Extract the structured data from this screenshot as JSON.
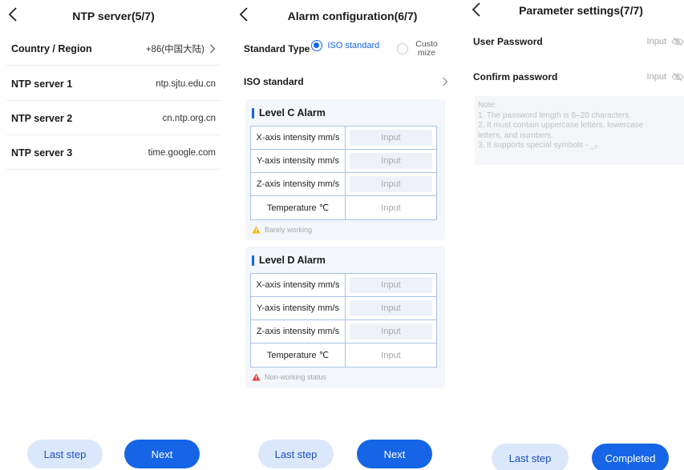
{
  "screen1": {
    "title": "NTP server(5/7)",
    "rows": [
      {
        "label": "Country / Region",
        "value": "+86(中国大陆)"
      },
      {
        "label": "NTP server 1",
        "value": "ntp.sjtu.edu.cn"
      },
      {
        "label": "NTP server 2",
        "value": "cn.ntp.org.cn"
      },
      {
        "label": "NTP server 3",
        "value": "time.google.com"
      }
    ],
    "prev_label": "Last step",
    "next_label": "Next"
  },
  "screen2": {
    "title": "Alarm configuration(6/7)",
    "standard_type_label": "Standard Type",
    "option_iso": "ISO standard",
    "option_custom_line1": "Custo",
    "option_custom_line2": "mize",
    "iso_row_label": "ISO standard",
    "level_c": {
      "title": "Level C Alarm",
      "rows": [
        {
          "label": "X-axis intensity mm/s",
          "placeholder": "Input"
        },
        {
          "label": "Y-axis intensity mm/s",
          "placeholder": "Input"
        },
        {
          "label": "Z-axis intensity mm/s",
          "placeholder": "Input"
        },
        {
          "label": "Temperature ℃",
          "placeholder": "Input"
        }
      ],
      "status": "Barely working"
    },
    "level_d": {
      "title": "Level D Alarm",
      "rows": [
        {
          "label": "X-axis intensity mm/s",
          "placeholder": "Input"
        },
        {
          "label": "Y-axis intensity mm/s",
          "placeholder": "Input"
        },
        {
          "label": "Z-axis intensity mm/s",
          "placeholder": "Input"
        },
        {
          "label": "Temperature ℃",
          "placeholder": "Input"
        }
      ],
      "status": "Non-working status"
    },
    "prev_label": "Last step",
    "next_label": "Next"
  },
  "screen3": {
    "title": "Parameter settings(7/7)",
    "user_password_label": "User Password",
    "user_password_placeholder": "Input",
    "confirm_password_label": "Confirm password",
    "confirm_password_placeholder": "Input",
    "note_lines": [
      "Note:",
      "1. The password length is 6–20 characters.",
      "2. It must contain uppercase letters, lowercase",
      "letters, and numbers.",
      "3. It supports special symbols - _。"
    ],
    "prev_label": "Last step",
    "done_label": "Completed"
  },
  "icons": {
    "back": "chevron-left-icon",
    "forward": "chevron-right-icon",
    "eye_hidden": "eye-off-icon",
    "warning": "warning-triangle-icon"
  },
  "colors": {
    "primary": "#1565e6",
    "primary_light": "#dbe8fb",
    "warning_yellow": "#f5b800",
    "danger_red": "#e53935",
    "grid_border": "#a8c3e8"
  }
}
